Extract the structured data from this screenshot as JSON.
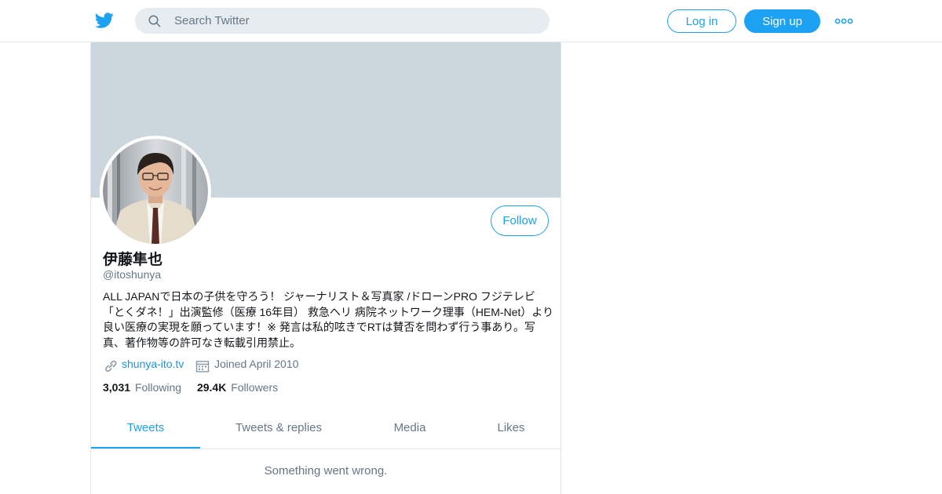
{
  "header": {
    "search_placeholder": "Search Twitter",
    "login_label": "Log in",
    "signup_label": "Sign up",
    "icons": {
      "logo": "twitter-bird-icon",
      "search": "search-icon",
      "more": "more-dots-icon"
    }
  },
  "profile": {
    "name": "伊藤隼也",
    "handle": "@itoshunya",
    "follow_label": "Follow",
    "bio": "ALL JAPANで日本の子供を守ろう！ ジャーナリスト＆写真家 /ドローンPRO フジテレビ「とくダネ！」出演監修（医療 16年目） 救急ヘリ 病院ネットワーク理事（HEM-Net）より良い医療の実現を願っています！※ 発言は私的呟きでRTは賛否を問わず行う事あり。写真、著作物等の許可なき転載引用禁止。",
    "url": "shunya-ito.tv",
    "joined": "Joined April 2010",
    "following_count": "3,031",
    "following_label": "Following",
    "followers_count": "29.4K",
    "followers_label": "Followers"
  },
  "tabs": [
    {
      "label": "Tweets",
      "active": true
    },
    {
      "label": "Tweets & replies",
      "active": false
    },
    {
      "label": "Media",
      "active": false
    },
    {
      "label": "Likes",
      "active": false
    }
  ],
  "timeline": {
    "error_message": "Something went wrong."
  },
  "colors": {
    "accent": "#1da1f2",
    "banner": "#ccd6dd",
    "muted_text": "#657786",
    "link": "#1b95e0"
  }
}
